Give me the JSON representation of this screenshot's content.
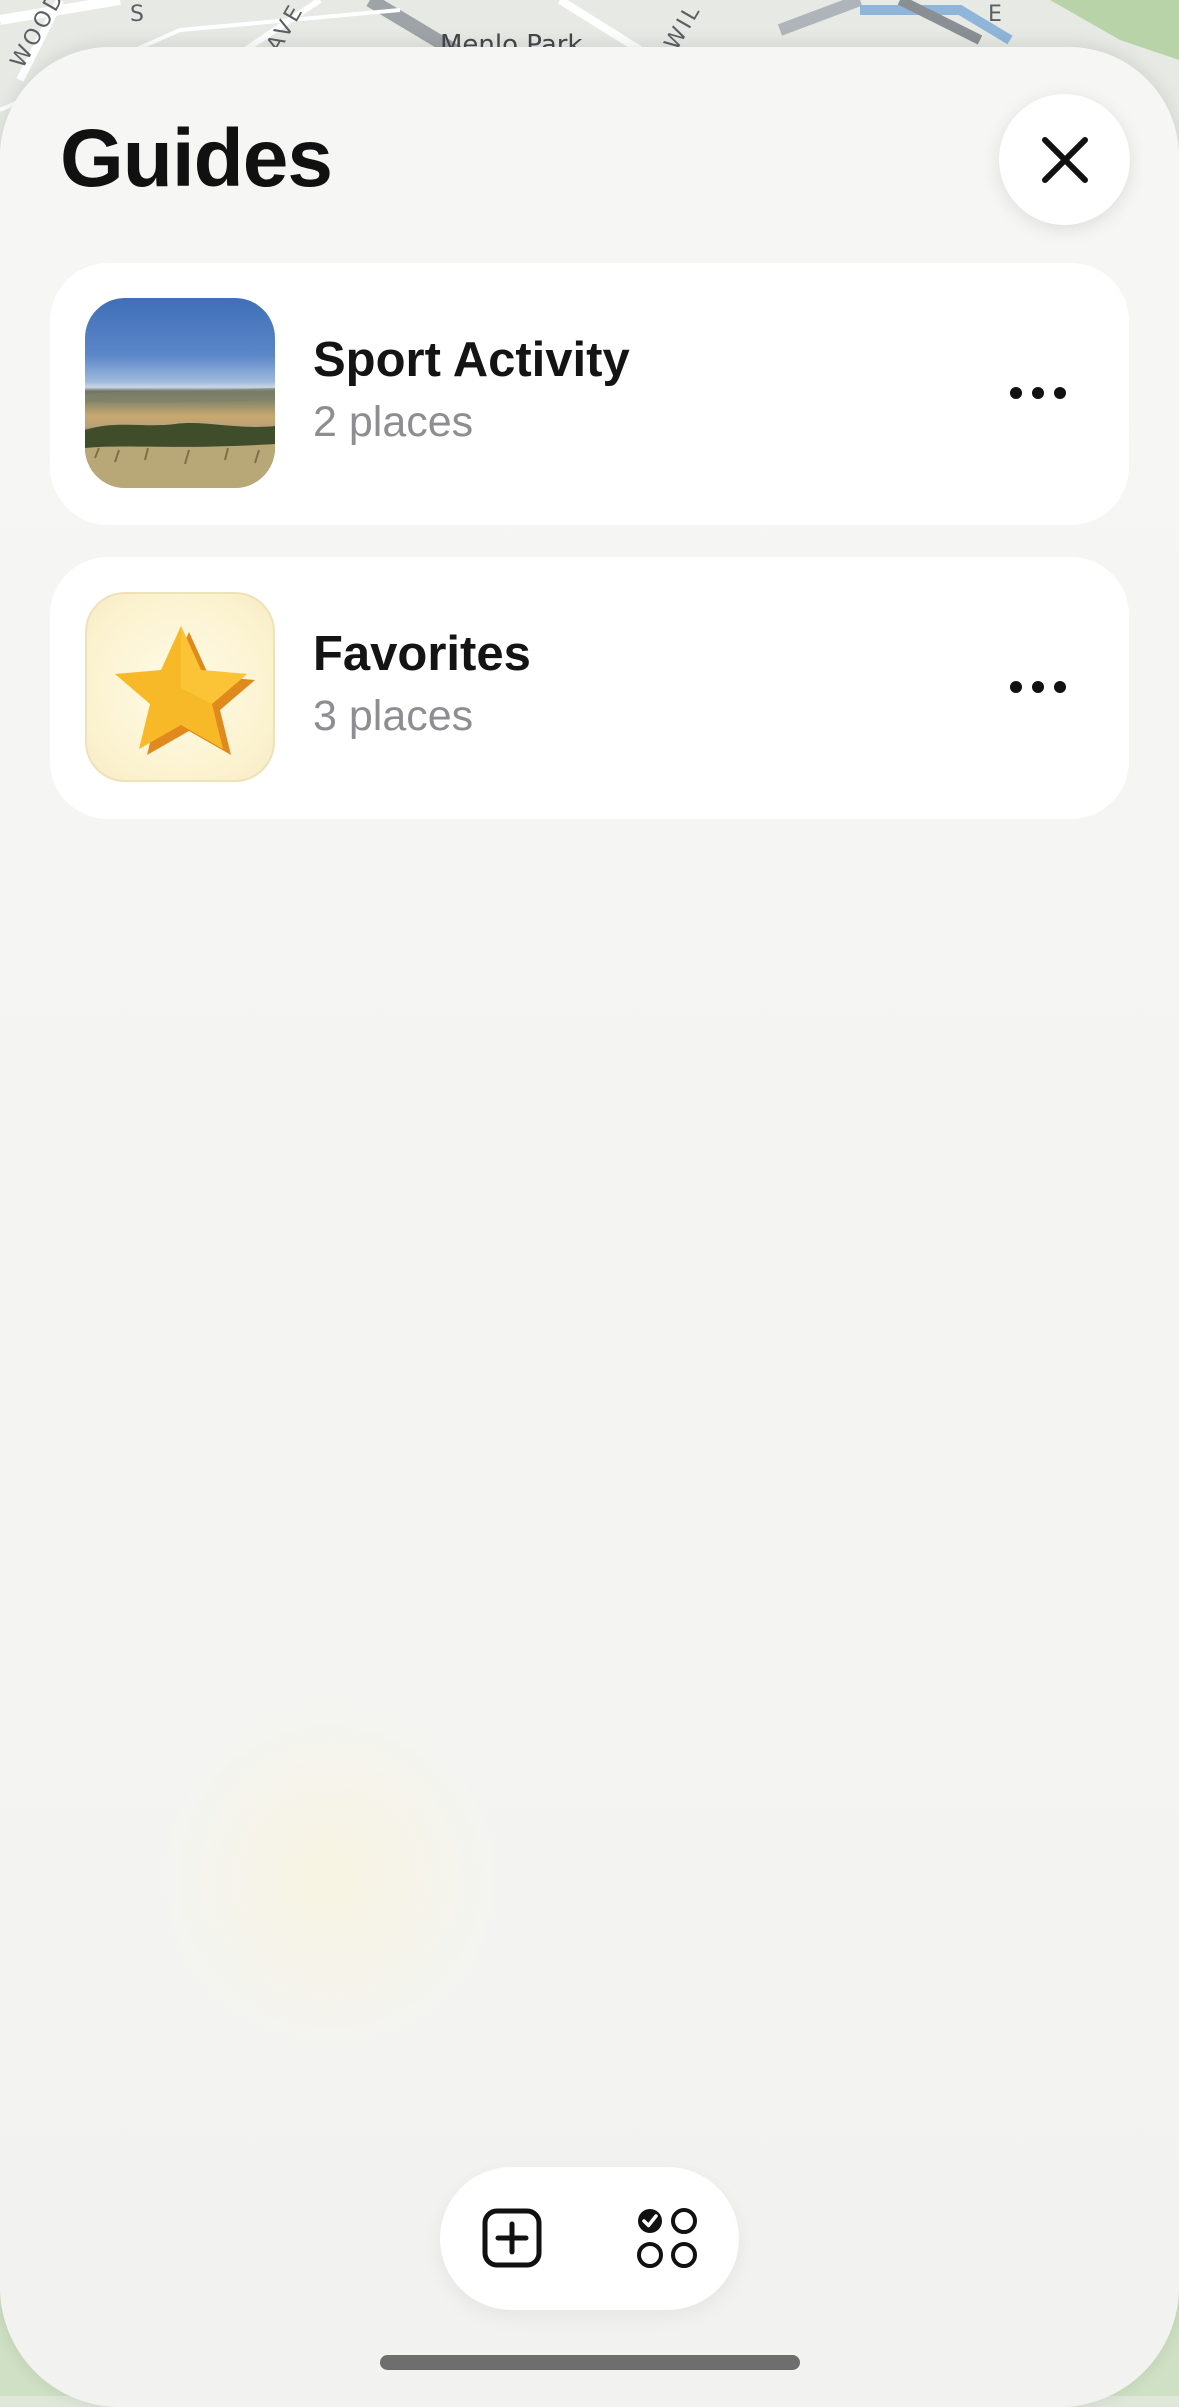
{
  "map": {
    "street_labels": [
      "WOODSI",
      "S",
      "AVE",
      "Menlo Park",
      "WIL",
      "E"
    ]
  },
  "sheet": {
    "title": "Guides"
  },
  "close_icon": "close-icon",
  "guides": [
    {
      "title": "Sport Activity",
      "subtitle": "2 places",
      "thumbnail": "landscape-photo",
      "more_icon": "ellipsis-icon"
    },
    {
      "title": "Favorites",
      "subtitle": "3 places",
      "thumbnail": "star-icon",
      "more_icon": "ellipsis-icon"
    }
  ],
  "toolbar": {
    "add_icon": "plus-square-icon",
    "organize_icon": "grid-check-icon"
  },
  "colors": {
    "sheet_background": "#f5f5f4",
    "card_background": "#ffffff",
    "title_text": "#111111",
    "subtitle_text": "#8e8e92",
    "star_fill": "#f7b928"
  }
}
